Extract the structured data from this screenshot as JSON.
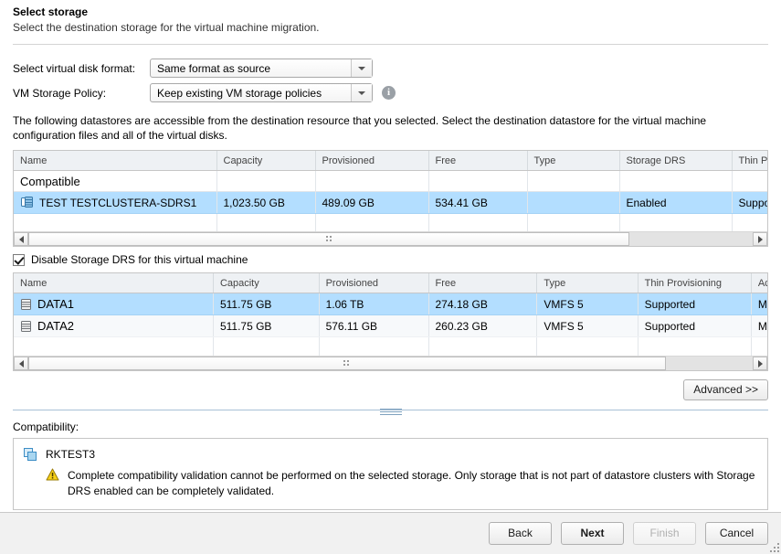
{
  "header": {
    "title": "Select storage",
    "subtitle": "Select the destination storage for the virtual machine migration."
  },
  "form": {
    "disk_format_label": "Select virtual disk format:",
    "disk_format_value": "Same format as source",
    "storage_policy_label": "VM Storage Policy:",
    "storage_policy_value": "Keep existing VM storage policies",
    "info_glyph": "i"
  },
  "description": "The following datastores are accessible from the destination resource that you selected. Select the destination datastore for the virtual machine configuration files and all of the virtual disks.",
  "cluster_table": {
    "columns": [
      "Name",
      "Capacity",
      "Provisioned",
      "Free",
      "Type",
      "Storage DRS",
      "Thin Prov"
    ],
    "group_label": "Compatible",
    "rows": [
      {
        "name": "TEST TESTCLUSTERA-SDRS1",
        "capacity": "1,023.50 GB",
        "provisioned": "489.09 GB",
        "free": "534.41 GB",
        "type": "",
        "storage_drs": "Enabled",
        "thin_prov": "Suppor",
        "selected": true,
        "icon": "datastore-cluster-icon"
      }
    ]
  },
  "disable_sdrs": {
    "label": "Disable Storage DRS for this virtual machine",
    "checked": true
  },
  "datastore_table": {
    "columns": [
      "Name",
      "Capacity",
      "Provisioned",
      "Free",
      "Type",
      "Thin Provisioning",
      "Access"
    ],
    "rows": [
      {
        "name": "DATA1",
        "capacity": "511.75 GB",
        "provisioned": "1.06 TB",
        "free": "274.18 GB",
        "type": "VMFS 5",
        "thin_provisioning": "Supported",
        "access": "Multiple ho",
        "selected": true,
        "icon": "datastore-icon"
      },
      {
        "name": "DATA2",
        "capacity": "511.75 GB",
        "provisioned": "576.11 GB",
        "free": "260.23 GB",
        "type": "VMFS 5",
        "thin_provisioning": "Supported",
        "access": "Multiple ho",
        "selected": false,
        "icon": "datastore-icon"
      }
    ]
  },
  "advanced_button": "Advanced >>",
  "compatibility": {
    "label": "Compatibility:",
    "vm_name": "RKTEST3",
    "warning": "Complete compatibility validation cannot be performed on the selected storage. Only storage that is not part of datastore clusters with Storage DRS enabled can be completely validated."
  },
  "footer": {
    "back": "Back",
    "next": "Next",
    "finish": "Finish",
    "cancel": "Cancel"
  },
  "colors": {
    "selection": "#b3deff",
    "header_bg": "#eef1f4",
    "warning": "#f2c11c",
    "link_blue": "#3c8dc5"
  }
}
